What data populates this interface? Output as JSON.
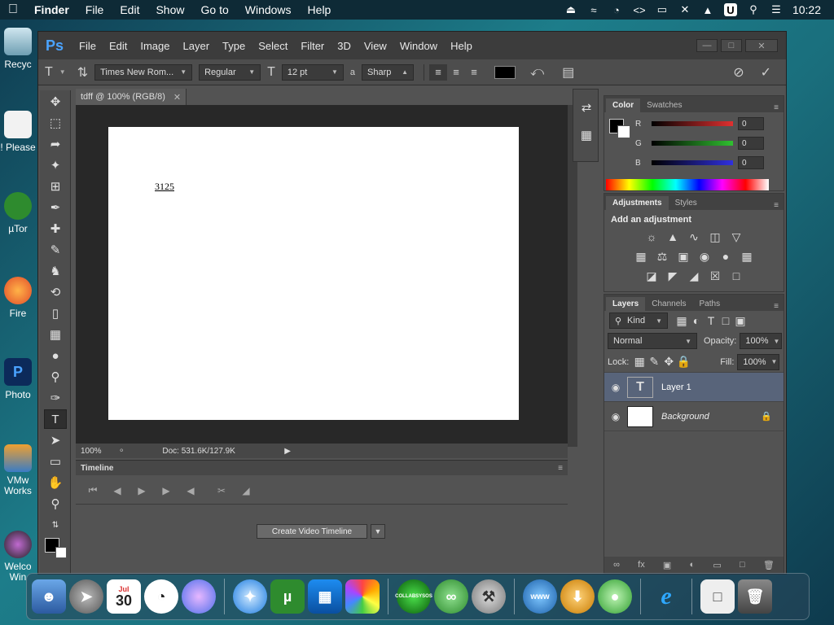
{
  "menubar": {
    "apple": "",
    "app_name": "Finder",
    "items": [
      "File",
      "Edit",
      "Show",
      "Go to",
      "Windows",
      "Help"
    ],
    "clock": "10:22",
    "status_icons": [
      "eject-icon",
      "wifi-off-icon",
      "timer-icon",
      "code-icon",
      "display-icon",
      "no-signal-icon",
      "upload-icon",
      "user-u-icon",
      "search-icon",
      "control-center-icon"
    ]
  },
  "desktop_icons": [
    {
      "label": "Recyc",
      "icon": "recycle-bin-icon"
    },
    {
      "label": "! Please",
      "icon": "note-icon"
    },
    {
      "label": "µTor",
      "icon": "utorrent-icon"
    },
    {
      "label": "Fire",
      "icon": "firefox-icon"
    },
    {
      "label": "Photo",
      "icon": "photoshop-icon"
    },
    {
      "label": "VMw\nWorks",
      "icon": "vmware-icon"
    },
    {
      "label": "Welco\nWin",
      "icon": "welcome-icon"
    }
  ],
  "ps": {
    "logo": "Ps",
    "menu": [
      "File",
      "Edit",
      "Image",
      "Layer",
      "Type",
      "Select",
      "Filter",
      "3D",
      "View",
      "Window",
      "Help"
    ],
    "options": {
      "font_family": "Times New Rom...",
      "font_style": "Regular",
      "font_size": "12 pt",
      "antialias": "Sharp",
      "aa_label": "a",
      "color": "#000000"
    },
    "doc_tab": "tdff @ 100% (RGB/8)",
    "canvas_text": "3125",
    "status": {
      "zoom": "100%",
      "doc": "Doc: 531.6K/127.9K"
    },
    "timeline": {
      "tab": "Timeline",
      "create_button": "Create Video Timeline"
    },
    "color_panel": {
      "tabs": [
        "Color",
        "Swatches"
      ],
      "channels": [
        {
          "label": "R",
          "value": "0",
          "color": "#e03030"
        },
        {
          "label": "G",
          "value": "0",
          "color": "#30c030"
        },
        {
          "label": "B",
          "value": "0",
          "color": "#3030e0"
        }
      ]
    },
    "adj_panel": {
      "tabs": [
        "Adjustments",
        "Styles"
      ],
      "heading": "Add an adjustment"
    },
    "layers_panel": {
      "tabs": [
        "Layers",
        "Channels",
        "Paths"
      ],
      "kind": "Kind",
      "blend_mode": "Normal",
      "opacity_label": "Opacity:",
      "opacity": "100%",
      "lock_label": "Lock:",
      "fill_label": "Fill:",
      "fill": "100%",
      "layers": [
        {
          "name": "Layer 1",
          "type": "text",
          "selected": true
        },
        {
          "name": "Background",
          "type": "image",
          "selected": false,
          "locked": true
        }
      ]
    }
  },
  "dock": {
    "calendar_month": "Jul",
    "calendar_day": "30",
    "collabsysos": "COLLABSYSOS",
    "www": "www"
  }
}
